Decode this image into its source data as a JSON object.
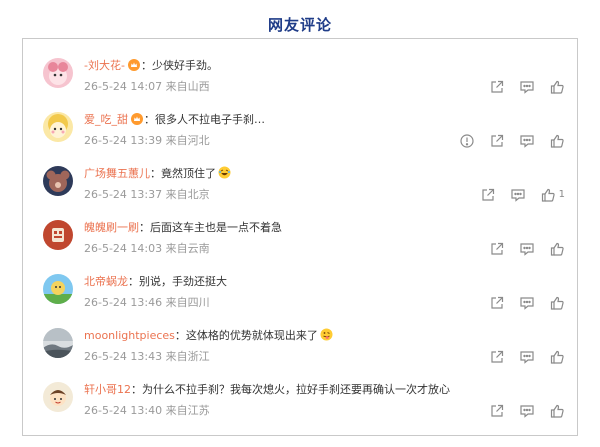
{
  "title": "网友评论",
  "colors": {
    "title": "#1f3c88",
    "username": "#eb7350",
    "meta": "#9a9a9a",
    "icon": "#8a8a8a"
  },
  "comments": [
    {
      "user": "-刘大花-",
      "badge": "crown-icon",
      "separator": "：",
      "text": "少侠好手劲。",
      "emoji": "",
      "time": "26-5-24 14:07",
      "location": "来自山西",
      "like_count": "",
      "has_report": false
    },
    {
      "user": "爱_吃_甜",
      "badge": "crown-icon",
      "separator": "：",
      "text": "很多人不拉电子手刹…",
      "emoji": "",
      "time": "26-5-24 13:39",
      "location": "来自河北",
      "like_count": "",
      "has_report": true
    },
    {
      "user": "广场舞五蕙儿",
      "badge": "",
      "separator": "：",
      "text": "竟然顶住了",
      "emoji": "laughing-emoji-icon",
      "time": "26-5-24 13:37",
      "location": "来自北京",
      "like_count": "1",
      "has_report": false
    },
    {
      "user": "魄魄刷一刷",
      "badge": "",
      "separator": "：",
      "text": "后面这车主也是一点不着急",
      "emoji": "",
      "time": "26-5-24 14:03",
      "location": "来自云南",
      "like_count": "",
      "has_report": false
    },
    {
      "user": "北帝蜗龙",
      "badge": "",
      "separator": "：",
      "text": "别说，手劲还挺大",
      "emoji": "",
      "time": "26-5-24 13:46",
      "location": "来自四川",
      "like_count": "",
      "has_report": false
    },
    {
      "user": "moonlightpieces",
      "badge": "",
      "separator": "：",
      "text": "这体格的优势就体现出来了",
      "emoji": "tongue-emoji-icon",
      "time": "26-5-24 13:43",
      "location": "来自浙江",
      "like_count": "",
      "has_report": false
    },
    {
      "user": "轩小哥12",
      "badge": "",
      "separator": "：",
      "text": "为什么不拉手刹？我每次熄火，拉好手刹还要再确认一次才放心",
      "emoji": "",
      "time": "26-5-24 13:40",
      "location": "来自江苏",
      "like_count": "",
      "has_report": false
    }
  ]
}
